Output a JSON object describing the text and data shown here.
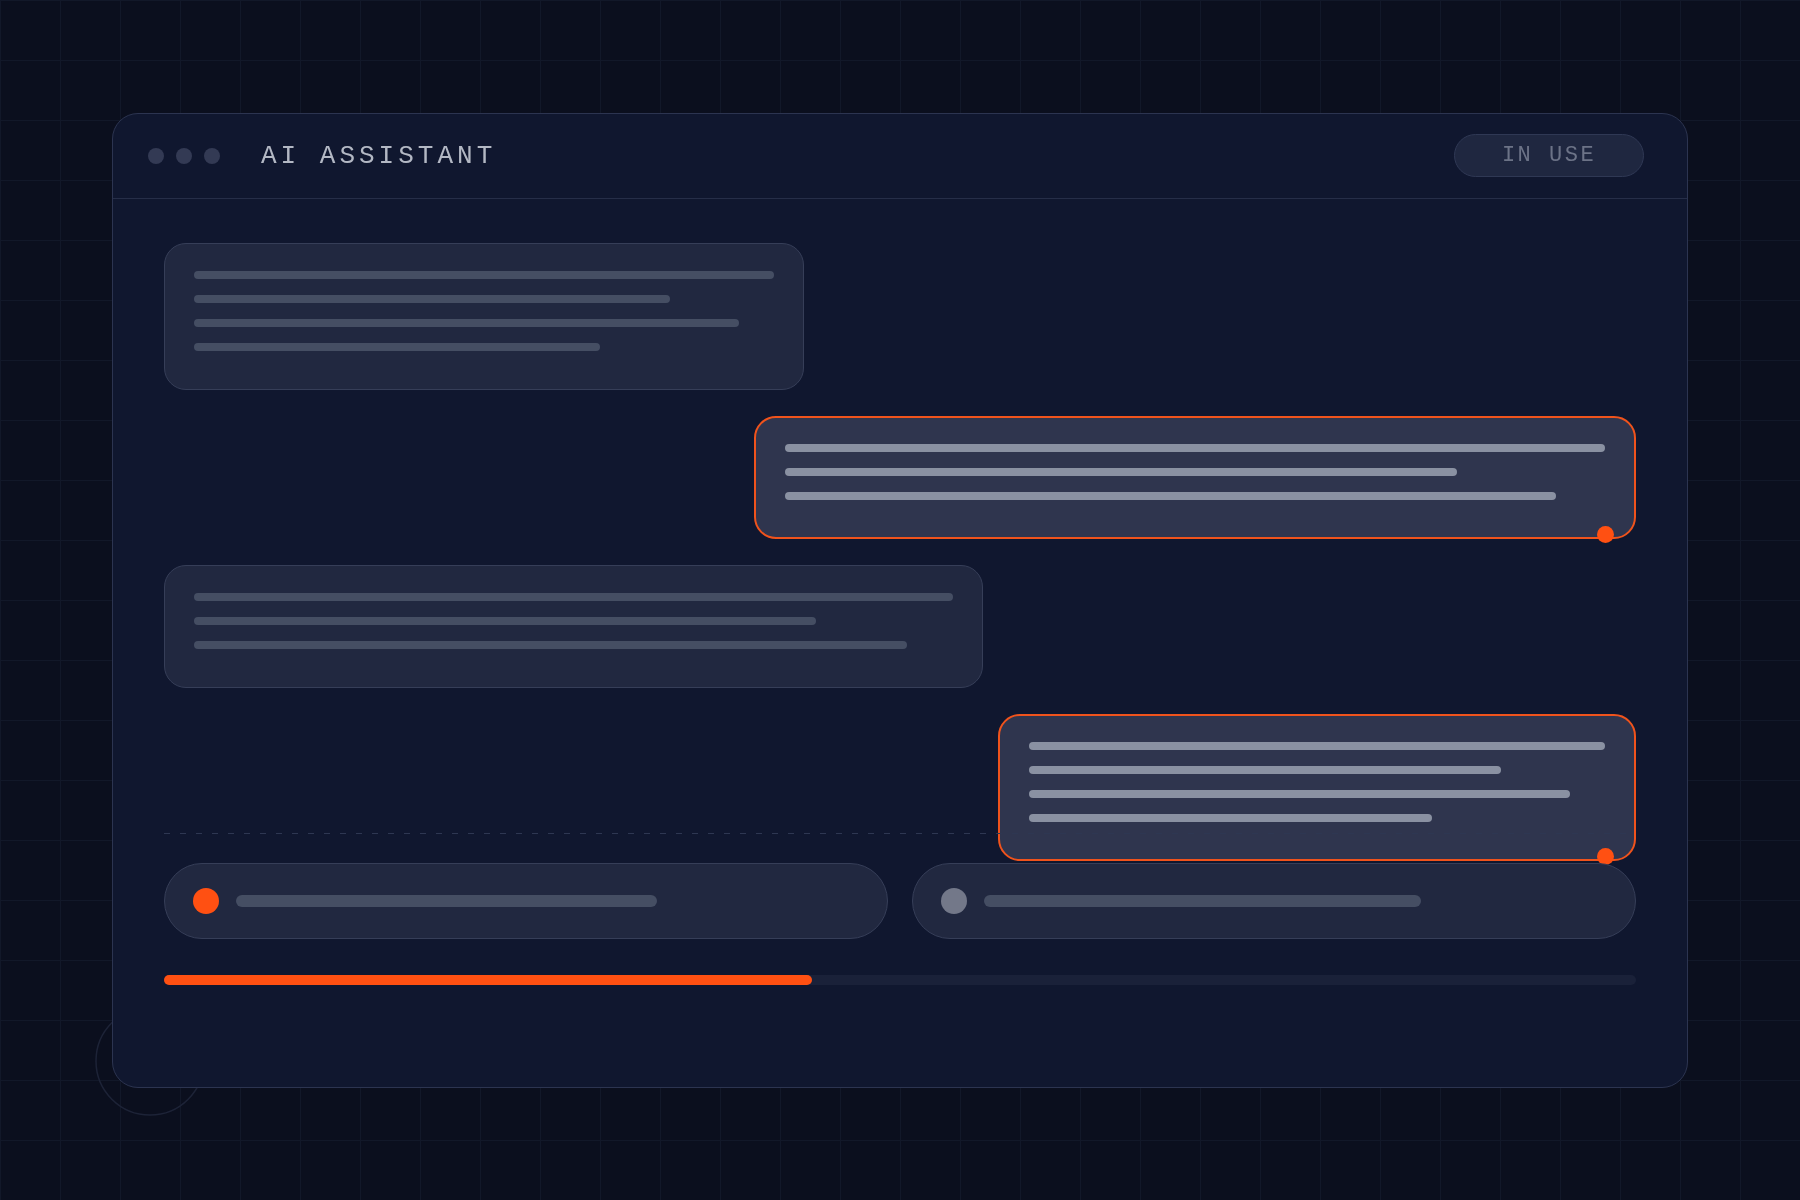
{
  "window": {
    "title": "AI ASSISTANT",
    "status_badge": "IN USE"
  },
  "messages": [
    {
      "kind": "assistant"
    },
    {
      "kind": "user"
    },
    {
      "kind": "assistant"
    },
    {
      "kind": "user"
    }
  ],
  "options": [
    {
      "selected": true
    },
    {
      "selected": false
    }
  ],
  "progress": {
    "level": 0.44
  }
}
